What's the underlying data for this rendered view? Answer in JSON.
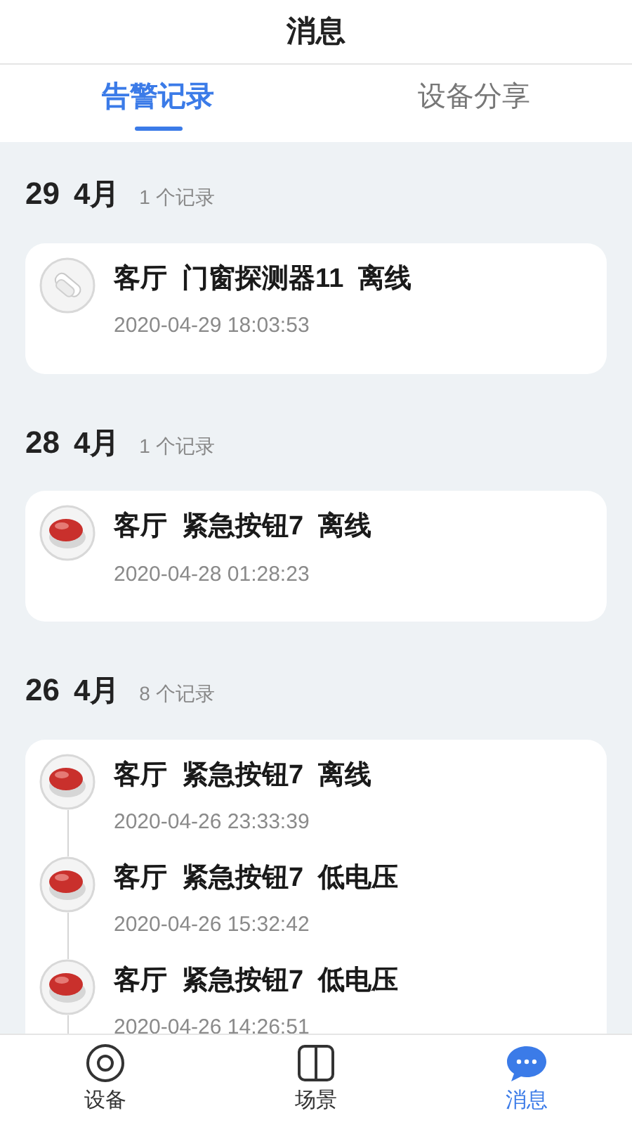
{
  "header": {
    "title": "消息"
  },
  "tabs": [
    {
      "label": "告警记录",
      "selected": true
    },
    {
      "label": "设备分享",
      "selected": false
    }
  ],
  "groups": [
    {
      "day": "29",
      "month": "4月",
      "count": "1 个记录",
      "records": [
        {
          "kind": "sensor",
          "title": "客厅  门窗探测器11  离线",
          "time": "2020-04-29 18:03:53"
        }
      ]
    },
    {
      "day": "28",
      "month": "4月",
      "count": "1 个记录",
      "records": [
        {
          "kind": "button",
          "title": "客厅  紧急按钮7  离线",
          "time": "2020-04-28 01:28:23"
        }
      ]
    },
    {
      "day": "26",
      "month": "4月",
      "count": "8 个记录",
      "records": [
        {
          "kind": "button",
          "title": "客厅  紧急按钮7  离线",
          "time": "2020-04-26 23:33:39"
        },
        {
          "kind": "button",
          "title": "客厅  紧急按钮7  低电压",
          "time": "2020-04-26 15:32:42"
        },
        {
          "kind": "button",
          "title": "客厅  紧急按钮7  低电压",
          "time": "2020-04-26 14:26:51"
        }
      ]
    }
  ],
  "nav": [
    {
      "kind": "device",
      "label": "设备",
      "selected": false
    },
    {
      "kind": "scene",
      "label": "场景",
      "selected": false
    },
    {
      "kind": "message",
      "label": "消息",
      "selected": true
    }
  ]
}
